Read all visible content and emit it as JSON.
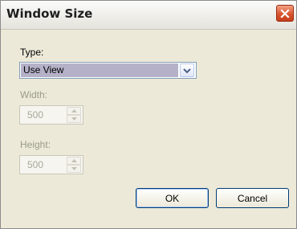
{
  "window": {
    "title": "Window Size"
  },
  "form": {
    "type_label": "Type:",
    "type_value": "Use View",
    "width_label": "Width:",
    "width_value": "500",
    "height_label": "Height:",
    "height_value": "500"
  },
  "buttons": {
    "ok": "OK",
    "cancel": "Cancel"
  },
  "icons": {
    "close": "close-icon",
    "dropdown": "chevron-down-icon",
    "spin_up": "spin-up-arrow-icon",
    "spin_down": "spin-down-arrow-icon"
  },
  "colors": {
    "close_button": "#d8552e",
    "selected_value_bg": "#b4b1c8",
    "dialog_bg": "#ece9d8"
  }
}
